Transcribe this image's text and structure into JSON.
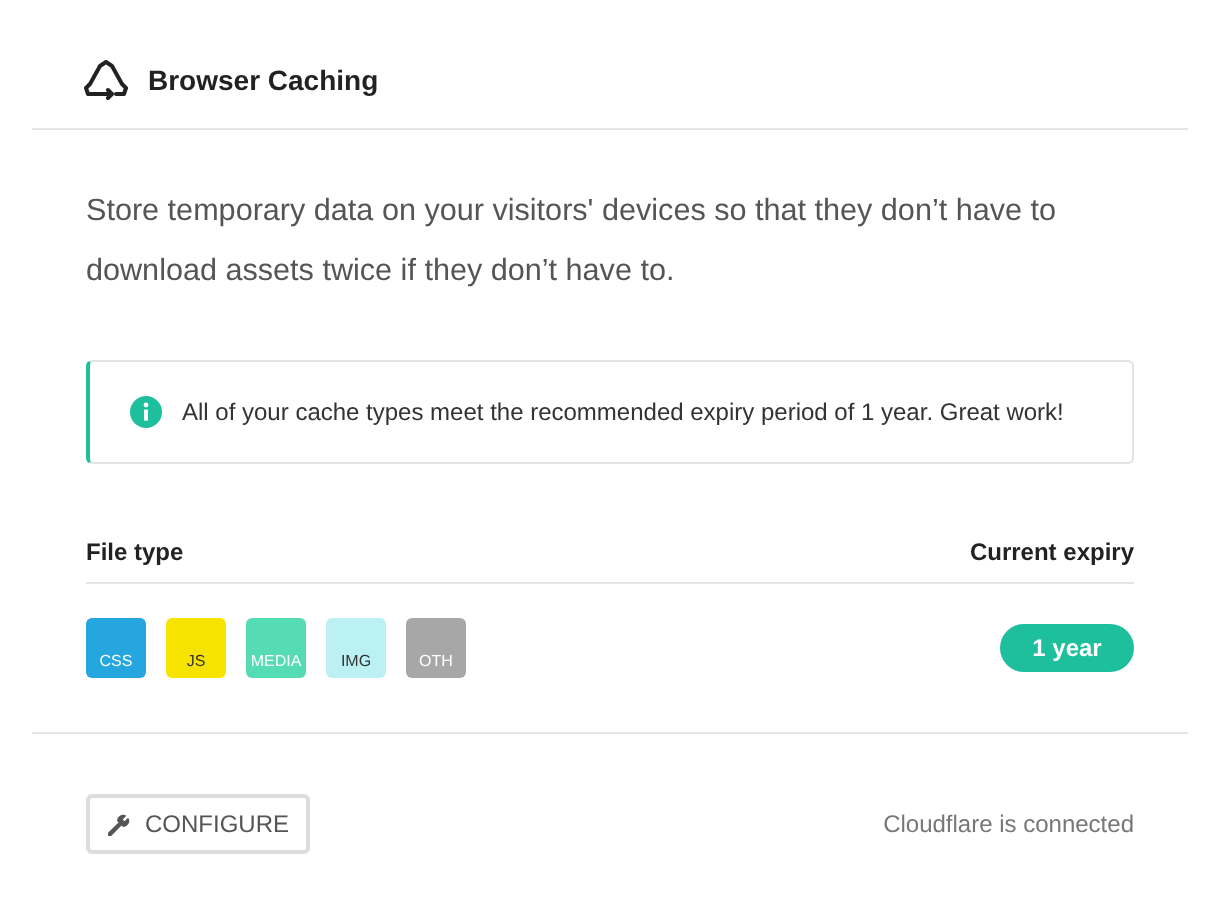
{
  "header": {
    "title": "Browser Caching"
  },
  "description": "Store temporary data on your visitors' devices so that they don’t have to download assets twice if they don’t have to.",
  "notice": {
    "text": "All of your cache types meet the recommended expiry period of 1 year. Great work!"
  },
  "table": {
    "columns": [
      "File type",
      "Current expiry"
    ],
    "file_types": [
      {
        "label": "CSS",
        "color": "#25a6de"
      },
      {
        "label": "JS",
        "color": "#f7e300"
      },
      {
        "label": "MEDIA",
        "color": "#55dcb5"
      },
      {
        "label": "IMG",
        "color": "#bcf1f4"
      },
      {
        "label": "OTH",
        "color": "#a7a7a7"
      }
    ],
    "expiry": "1 year"
  },
  "footer": {
    "button": "CONFIGURE",
    "status": "Cloudflare is connected"
  }
}
